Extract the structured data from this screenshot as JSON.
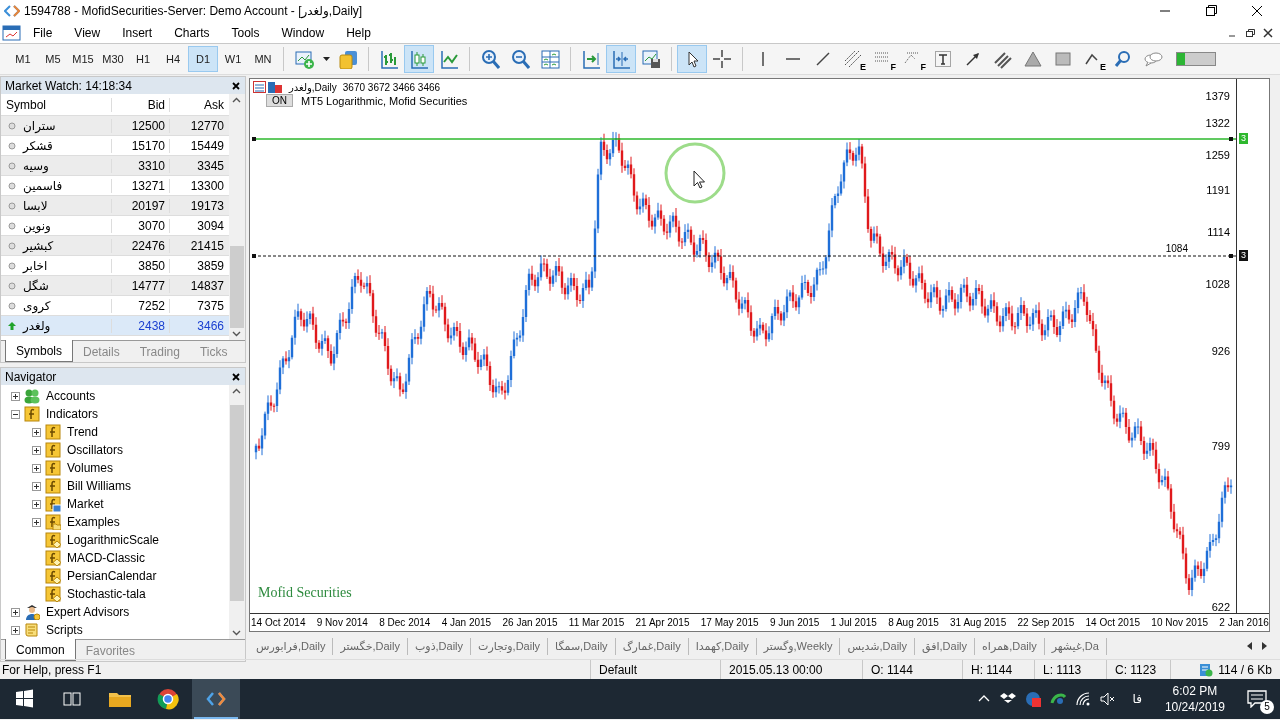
{
  "window": {
    "title": "1594788 - MofidSecurities-Server: Demo Account - [ولغدر,Daily]"
  },
  "menu": [
    "File",
    "View",
    "Insert",
    "Charts",
    "Tools",
    "Window",
    "Help"
  ],
  "toolbar": {
    "timeframes": [
      {
        "label": "M1",
        "selected": false
      },
      {
        "label": "M5",
        "selected": false
      },
      {
        "label": "M15",
        "selected": false
      },
      {
        "label": "M30",
        "selected": false
      },
      {
        "label": "H1",
        "selected": false
      },
      {
        "label": "H4",
        "selected": false
      },
      {
        "label": "D1",
        "selected": true
      },
      {
        "label": "W1",
        "selected": false
      },
      {
        "label": "MN",
        "selected": false
      }
    ],
    "tool_groups": [
      [
        {
          "kind": "new-chart",
          "selected": false
        },
        {
          "kind": "dropdown",
          "selected": false
        },
        {
          "kind": "coins",
          "selected": false
        }
      ],
      [
        {
          "kind": "bars",
          "selected": false
        },
        {
          "kind": "candles",
          "selected": true
        },
        {
          "kind": "line",
          "selected": false
        }
      ],
      [
        {
          "kind": "zoom-in",
          "selected": false
        },
        {
          "kind": "zoom-out",
          "selected": false
        },
        {
          "kind": "tile",
          "selected": false
        }
      ],
      [
        {
          "kind": "shift",
          "selected": false
        },
        {
          "kind": "autoscroll",
          "selected": true
        },
        {
          "kind": "template",
          "selected": false
        }
      ],
      [
        {
          "kind": "cursor",
          "selected": true
        },
        {
          "kind": "crosshair",
          "selected": false
        }
      ],
      [
        {
          "kind": "vline",
          "selected": false
        },
        {
          "kind": "hline",
          "selected": false
        },
        {
          "kind": "trend",
          "selected": false
        },
        {
          "kind": "fibo",
          "letter": "E",
          "selected": false
        },
        {
          "kind": "grid",
          "letter": "F",
          "selected": false
        },
        {
          "kind": "fan",
          "letter": "F",
          "selected": false
        },
        {
          "kind": "text",
          "selected": false
        },
        {
          "kind": "arrow",
          "selected": false
        },
        {
          "kind": "channel",
          "selected": false
        },
        {
          "kind": "triangle",
          "selected": false
        },
        {
          "kind": "rectangle",
          "selected": false
        },
        {
          "kind": "angle",
          "letter": "E",
          "selected": false
        },
        {
          "kind": "search",
          "selected": false
        },
        {
          "kind": "chat",
          "selected": false
        }
      ]
    ]
  },
  "market_watch": {
    "title": "Market Watch: 14:18:34",
    "columns": [
      "Symbol",
      "Bid",
      "Ask"
    ],
    "rows": [
      {
        "symbol": "ستران",
        "bid": "12500",
        "ask": "12770",
        "rising": false,
        "selected": false
      },
      {
        "symbol": "قشکر",
        "bid": "15170",
        "ask": "15449",
        "rising": false,
        "selected": false
      },
      {
        "symbol": "وسیه",
        "bid": "3310",
        "ask": "3345",
        "rising": false,
        "selected": false
      },
      {
        "symbol": "فاسمین",
        "bid": "13271",
        "ask": "13300",
        "rising": false,
        "selected": false
      },
      {
        "symbol": "لابسا",
        "bid": "20197",
        "ask": "19173",
        "rising": false,
        "selected": false
      },
      {
        "symbol": "ونوین",
        "bid": "3070",
        "ask": "3094",
        "rising": false,
        "selected": false
      },
      {
        "symbol": "کبشیر",
        "bid": "22476",
        "ask": "21415",
        "rising": false,
        "selected": false
      },
      {
        "symbol": "اخابر",
        "bid": "3850",
        "ask": "3859",
        "rising": false,
        "selected": false
      },
      {
        "symbol": "شگل",
        "bid": "14777",
        "ask": "14837",
        "rising": false,
        "selected": false
      },
      {
        "symbol": "کروی",
        "bid": "7252",
        "ask": "7375",
        "rising": false,
        "selected": false
      },
      {
        "symbol": "ولغدر",
        "bid": "2438",
        "ask": "3466",
        "rising": true,
        "selected": true
      }
    ],
    "tabs": [
      {
        "label": "Symbols",
        "selected": true
      },
      {
        "label": "Details",
        "selected": false
      },
      {
        "label": "Trading",
        "selected": false
      },
      {
        "label": "Ticks",
        "selected": false
      }
    ]
  },
  "navigator": {
    "title": "Navigator",
    "items": [
      {
        "label": "Accounts",
        "kind": "accounts",
        "expanded": false
      },
      {
        "label": "Indicators",
        "kind": "indicator",
        "expanded": true,
        "children": [
          {
            "label": "Trend",
            "kind": "indicator",
            "expanded": false
          },
          {
            "label": "Oscillators",
            "kind": "indicator",
            "expanded": false
          },
          {
            "label": "Volumes",
            "kind": "indicator",
            "expanded": false
          },
          {
            "label": "Bill Williams",
            "kind": "indicator",
            "expanded": false
          },
          {
            "label": "Market",
            "kind": "market",
            "expanded": false
          },
          {
            "label": "Examples",
            "kind": "folder",
            "expanded": false
          },
          {
            "label": "LogarithmicScale",
            "kind": "custom"
          },
          {
            "label": "MACD-Classic",
            "kind": "custom"
          },
          {
            "label": "PersianCalendar",
            "kind": "custom"
          },
          {
            "label": "Stochastic-tala",
            "kind": "custom"
          }
        ]
      },
      {
        "label": "Expert Advisors",
        "kind": "expert",
        "expanded": false
      },
      {
        "label": "Scripts",
        "kind": "script",
        "expanded": false
      }
    ],
    "tabs": [
      {
        "label": "Common",
        "selected": true
      },
      {
        "label": "Favorites",
        "selected": false
      }
    ]
  },
  "chart": {
    "symbol": "ولغدر,Daily",
    "ohlc": "3670 3672 3466 3466",
    "indicator_state": "ON",
    "indicator": "MT5 Logarithmic, Mofid Securities",
    "logo": "Mofid Securities",
    "price_labels": [
      "1379",
      "1322",
      "1259",
      "1191",
      "1114",
      "1028",
      "926",
      "799",
      "622"
    ],
    "line_label": "1084",
    "line_markers": [
      "3",
      "3"
    ],
    "dates": [
      "14 Oct 2014",
      "9 Nov 2014",
      "8 Dec 2014",
      "4 Jan 2015",
      "26 Jan 2015",
      "11 Mar 2015",
      "21 Apr 2015",
      "17 May 2015",
      "9 Jun 2015",
      "1 Jul 2015",
      "8 Aug 2015",
      "31 Aug 2015",
      "22 Sep 2015",
      "14 Oct 2015",
      "10 Nov 2015",
      "2 Jan 2016"
    ]
  },
  "chart_tabs": [
    "فرابورس,Daily",
    "خگستر,Daily",
    "ذوب,Daily",
    "وتجارت,Daily",
    "سمگا,Daily",
    "غمارگ,Daily",
    "کهمدا,Daily",
    "وگستر,Weekly",
    "شدیس,Daily",
    "افق,Daily",
    "همراه,Daily",
    "غیشهر,Da"
  ],
  "status_bar": {
    "help": "For Help, press F1",
    "profile": "Default",
    "time": "2015.05.13 00:00",
    "open": "O: 1144",
    "high": "H: 1144",
    "low": "L: 1113",
    "close": "C: 1123",
    "traffic": "114 / 6 Kb"
  },
  "taskbar": {
    "language": "فا",
    "time": "6:02 PM",
    "date": "10/24/2019",
    "notifications": "5"
  }
}
